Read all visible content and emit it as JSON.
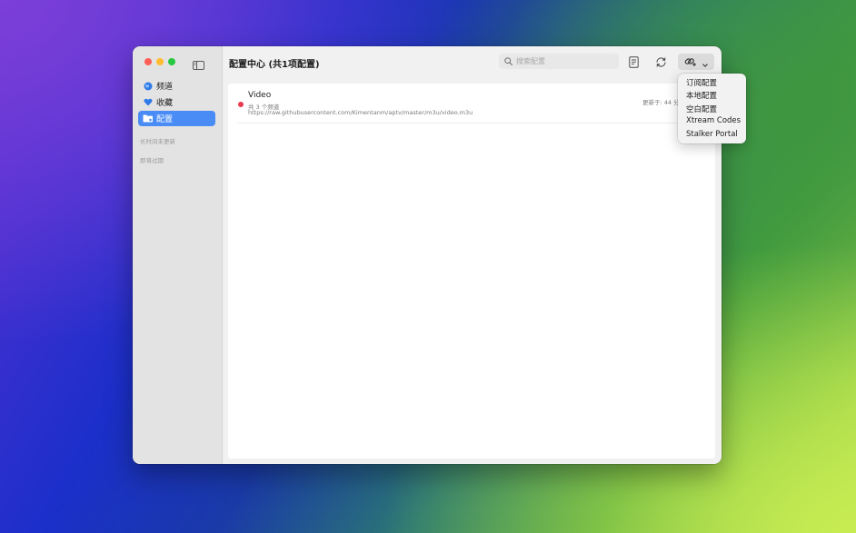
{
  "window": {
    "title": "配置中心 (共1项配置)"
  },
  "sidebar": {
    "items": [
      {
        "label": "频道",
        "icon": "globe-icon"
      },
      {
        "label": "收藏",
        "icon": "heart-icon"
      },
      {
        "label": "配置",
        "icon": "folder-icon",
        "active": true
      }
    ],
    "sections": [
      "长时间未更新",
      "即将过期"
    ]
  },
  "toolbar": {
    "search_placeholder": "搜索配置",
    "icons": [
      "document-icon",
      "refresh-icon",
      "add-link-icon",
      "chevron-down-icon"
    ]
  },
  "configs": [
    {
      "title": "Video",
      "channels": "共 3 个频道",
      "url": "https://raw.githubusercontent.com/Kimentanm/aptv/master/m3u/video.m3u",
      "updated": "更新于: 44 分",
      "status_color": "#e8394d"
    }
  ],
  "add_menu": {
    "items": [
      "订阅配置",
      "本地配置",
      "空白配置",
      "Xtream Codes",
      "Stalker Portal"
    ]
  },
  "colors": {
    "accent": "#4a8cf6",
    "status_red": "#e8394d"
  }
}
